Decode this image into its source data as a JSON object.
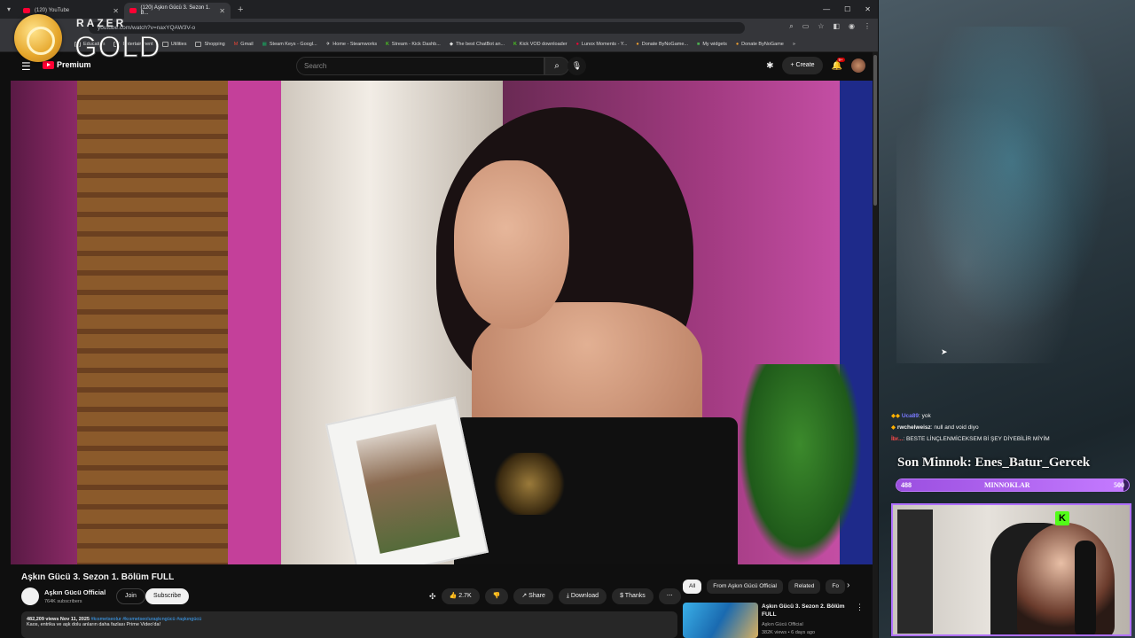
{
  "browser": {
    "tabs": [
      {
        "title": "(120) YouTube"
      },
      {
        "title": "(120) Aşkın Gücü 3. Sezon 1. B..."
      }
    ],
    "url": "youtube.com/watch?v=naxYQAW3V-o",
    "bookmarks": [
      "Education",
      "Entertainment",
      "Utilities",
      "Shopping",
      "Gmail",
      "Steam Keys - Googl...",
      "Home - Steamworks",
      "Stream - Kick Dashb...",
      "The best ChatBot an...",
      "Kick VOD downloader",
      "Lunox Moments - Y...",
      "Donate ByNoGame...",
      "My widgets",
      "Donate ByNoGame"
    ]
  },
  "overlay": {
    "razer_word": "RAZER",
    "gold_word": "GOLD"
  },
  "youtube": {
    "logo_text": "Premium",
    "search_placeholder": "Search",
    "create_label": "Create",
    "notif_count": "9+",
    "video": {
      "title": "Aşkın Gücü 3. Sezon 1. Bölüm FULL",
      "channel": "Aşkın Gücü Official",
      "subscribers": "764K subscribers",
      "join_label": "Join",
      "subscribe_label": "Subscribe",
      "likes": "2.7K",
      "share_label": "Share",
      "download_label": "Download",
      "thanks_label": "Thanks",
      "views_date": "482,209 views  Nov 11, 2025",
      "hashtags": "#kısmetseolur #kısmetseoluraşkıngücü #aşkıngücü",
      "description": "Kaos, entrika ve aşk dolu anların daha fazlası Prime Video'da!"
    },
    "chips": [
      "All",
      "From Aşkın Gücü Official",
      "Related",
      "Fo"
    ],
    "recommendation": {
      "title": "Aşkın Gücü 3. Sezon 2. Bölüm FULL",
      "channel": "Aşkın Gücü Official",
      "meta": "382K views • 6 days ago"
    }
  },
  "stream": {
    "chat": [
      {
        "user": "Uca89",
        "message": ": yok"
      },
      {
        "user": "rwchelweisz",
        "message": ": null and void diyo"
      },
      {
        "user": "İbr...",
        "message": ": BESTE LİNÇLENMİCEKSEM Bİ ŞEY DİYEBİLİR MİYİM"
      }
    ],
    "goal_title": "Son Minnok: Enes_Batur_Gercek",
    "goal_current": "488",
    "goal_label": "MINNOKLAR",
    "goal_target": "500",
    "goal_progress": 0.976,
    "platform_badge": "K"
  }
}
